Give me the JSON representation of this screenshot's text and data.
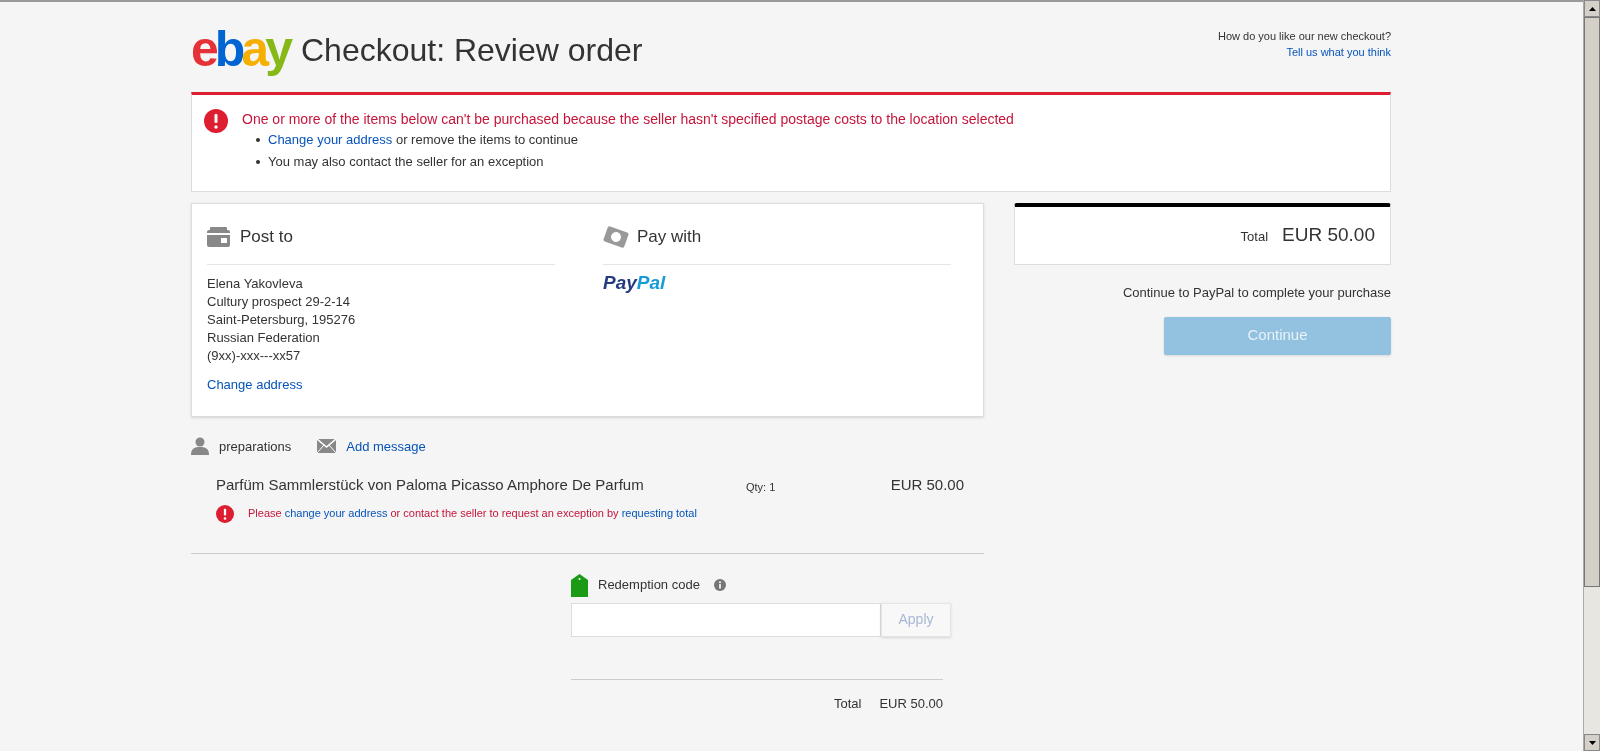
{
  "header": {
    "logo": "ebay",
    "title": "Checkout: Review order",
    "feedback_question": "How do you like our new checkout?",
    "feedback_link": "Tell us what you think"
  },
  "alert": {
    "message": "One or more of the items below can't be purchased because the seller hasn't specified postage costs to the location selected",
    "bullets": [
      [
        {
          "kind": "link",
          "text": "Change your address"
        },
        {
          "kind": "text",
          "text": " or remove the items to continue"
        }
      ],
      [
        {
          "kind": "text",
          "text": "You may also contact the seller for an exception"
        }
      ]
    ]
  },
  "post_to": {
    "heading": "Post to",
    "address_lines": [
      "Elena Yakovleva",
      "Cultury prospect 29-2-14",
      "Saint-Petersburg, 195276",
      "Russian Federation",
      "(9xx)-xxx---xx57"
    ],
    "change_link": "Change address"
  },
  "pay_with": {
    "heading": "Pay with",
    "logo_parts": [
      "Pay",
      "Pal"
    ]
  },
  "seller": {
    "name": "preparations",
    "message_link": "Add message"
  },
  "items": [
    {
      "title": "Parfüm Sammlerstück von Paloma Picasso Amphore De Parfum",
      "qty": "Qty: 1",
      "price": "EUR 50.00",
      "error": [
        {
          "kind": "text",
          "text": "Please "
        },
        {
          "kind": "link",
          "text": "change your address"
        },
        {
          "kind": "text",
          "text": " or contact the seller to request an exception by "
        },
        {
          "kind": "link",
          "text": "requesting total"
        }
      ]
    }
  ],
  "redemption": {
    "label": "Redemption code",
    "button": "Apply",
    "disabled": true
  },
  "order_total": {
    "label": "Total",
    "value": "EUR 50.00"
  },
  "summary": {
    "total_label": "Total",
    "total_value": "EUR 50.00",
    "note": "Continue to PayPal to complete your purchase",
    "button": "Continue",
    "disabled": true
  }
}
